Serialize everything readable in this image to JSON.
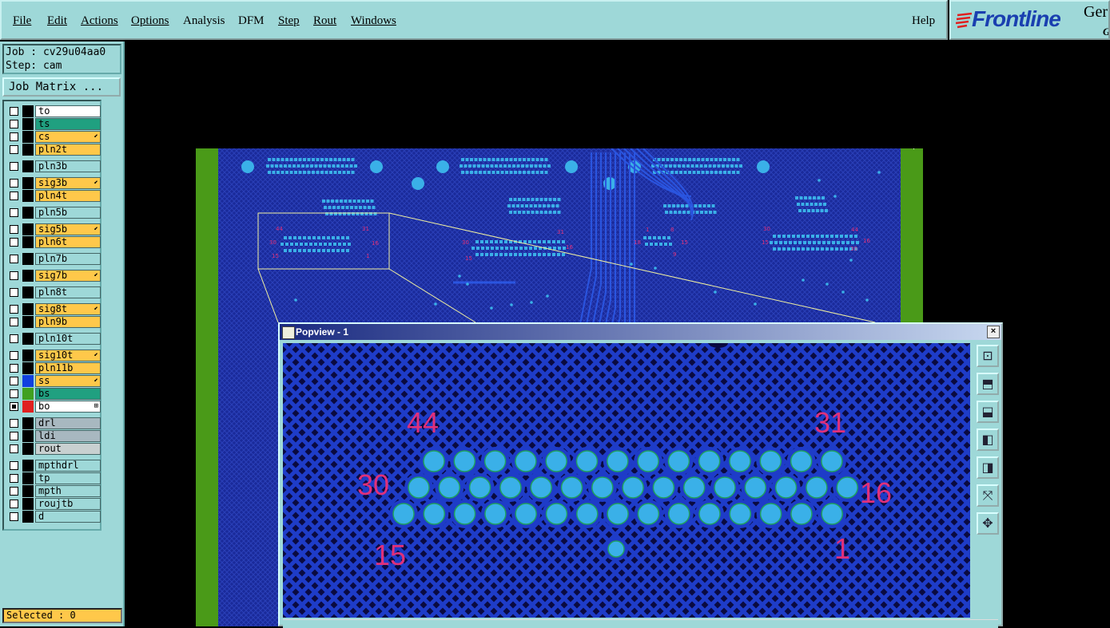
{
  "menubar": {
    "items": [
      {
        "label": "File"
      },
      {
        "label": "Edit"
      },
      {
        "label": "Actions"
      },
      {
        "label": "Options"
      },
      {
        "label": "Analysis"
      },
      {
        "label": "DFM"
      },
      {
        "label": "Step"
      },
      {
        "label": "Rout"
      },
      {
        "label": "Windows"
      }
    ],
    "help": "Help"
  },
  "logo": {
    "brand": "Frontline",
    "product": "Ger",
    "product_sub": "G"
  },
  "job": {
    "job_line": "Job : cv29u04aa0",
    "step_line": "Step: cam",
    "matrix_button": "Job Matrix ..."
  },
  "layers": [
    {
      "name": "to",
      "bg": "#ffffff",
      "swatch": "#000000",
      "mark": ""
    },
    {
      "name": "ts",
      "bg": "#20a080",
      "swatch": "#000000",
      "mark": ""
    },
    {
      "name": "cs",
      "bg": "#ffc84a",
      "swatch": "#000000",
      "mark": "⬋"
    },
    {
      "name": "pln2t",
      "bg": "#ffc84a",
      "swatch": "#000000",
      "mark": ""
    },
    {
      "name": "pln3b",
      "bg": "#9ed8d8",
      "swatch": "#000000",
      "mark": ""
    },
    {
      "name": "sig3b",
      "bg": "#ffc84a",
      "swatch": "#000000",
      "mark": "⬋"
    },
    {
      "name": "pln4t",
      "bg": "#ffc84a",
      "swatch": "#000000",
      "mark": ""
    },
    {
      "name": "pln5b",
      "bg": "#9ed8d8",
      "swatch": "#000000",
      "mark": ""
    },
    {
      "name": "sig5b",
      "bg": "#ffc84a",
      "swatch": "#000000",
      "mark": "⬋"
    },
    {
      "name": "pln6t",
      "bg": "#ffc84a",
      "swatch": "#000000",
      "mark": ""
    },
    {
      "name": "pln7b",
      "bg": "#9ed8d8",
      "swatch": "#000000",
      "mark": ""
    },
    {
      "name": "sig7b",
      "bg": "#ffc84a",
      "swatch": "#000000",
      "mark": "⬋"
    },
    {
      "name": "pln8t",
      "bg": "#9ed8d8",
      "swatch": "#000000",
      "mark": ""
    },
    {
      "name": "sig8t",
      "bg": "#ffc84a",
      "swatch": "#000000",
      "mark": "⬋"
    },
    {
      "name": "pln9b",
      "bg": "#ffc84a",
      "swatch": "#000000",
      "mark": ""
    },
    {
      "name": "pln10t",
      "bg": "#9ed8d8",
      "swatch": "#000000",
      "mark": ""
    },
    {
      "name": "sig10t",
      "bg": "#ffc84a",
      "swatch": "#000000",
      "mark": "⬋"
    },
    {
      "name": "pln11b",
      "bg": "#ffc84a",
      "swatch": "#000000",
      "mark": ""
    },
    {
      "name": "ss",
      "bg": "#ffc84a",
      "swatch": "#1040e0",
      "mark": "⬋"
    },
    {
      "name": "bs",
      "bg": "#20a080",
      "swatch": "#40a020",
      "mark": ""
    },
    {
      "name": "bo",
      "bg": "#ffffff",
      "swatch": "#e02020",
      "mark": "⊞"
    },
    {
      "name": "drl",
      "bg": "#a8b8c0",
      "swatch": "#000000",
      "mark": ""
    },
    {
      "name": "ldi",
      "bg": "#a8b8c0",
      "swatch": "#000000",
      "mark": ""
    },
    {
      "name": "rout",
      "bg": "#c8d0d0",
      "swatch": "#000000",
      "mark": ""
    },
    {
      "name": "mpthdrl",
      "bg": "#9ed8d8",
      "swatch": "#000000",
      "mark": ""
    },
    {
      "name": "tp",
      "bg": "#9ed8d8",
      "swatch": "#000000",
      "mark": ""
    },
    {
      "name": "mpth",
      "bg": "#9ed8d8",
      "swatch": "#000000",
      "mark": ""
    },
    {
      "name": "roujtb",
      "bg": "#9ed8d8",
      "swatch": "#000000",
      "mark": ""
    },
    {
      "name": "d",
      "bg": "#9ed8d8",
      "swatch": "#000000",
      "mark": ""
    }
  ],
  "status": {
    "selected": "Selected : 0"
  },
  "board": {
    "pin_labels_small": [
      "44",
      "31",
      "30",
      "16",
      "15",
      "1",
      "30",
      "31",
      "15",
      "16",
      "1",
      "8",
      "18",
      "15",
      "9",
      "30",
      "44",
      "15",
      "16",
      "30"
    ]
  },
  "popview": {
    "title": "Popview - 1",
    "close": "×",
    "pin_labels": {
      "tl": "44",
      "tr": "31",
      "ml": "30",
      "mr": "16",
      "bl": "15",
      "br": "1"
    },
    "tools": [
      "zoom-fit-icon",
      "move-up-icon",
      "move-down-icon",
      "move-left-icon",
      "move-right-icon",
      "zoom-out-icon",
      "zoom-in-icon"
    ]
  },
  "colors": {
    "panel": "#9ed8d8",
    "board": "#1a2a9a",
    "pad": "#3ab0e8",
    "trace": "#1e3cc8",
    "label": "#e0307a",
    "edge": "#4a9a18"
  }
}
